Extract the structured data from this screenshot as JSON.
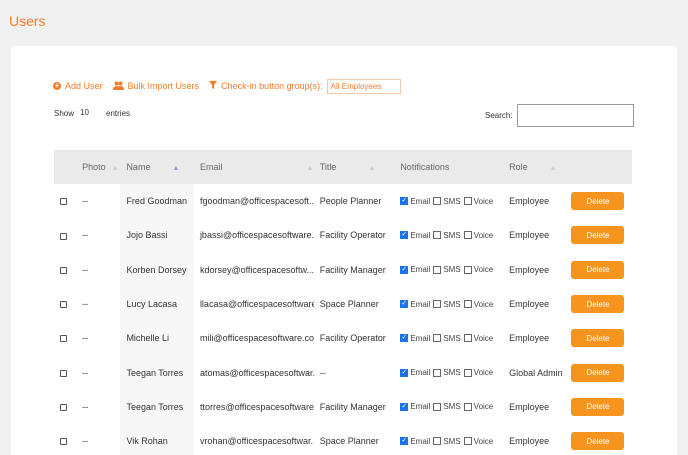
{
  "page_title": "Users",
  "toolbar": {
    "add_user": "Add User",
    "bulk_import": "Bulk Import Users",
    "checkin_label": "Check-in button group(s):",
    "checkin_value": "All Employees"
  },
  "show": {
    "prefix": "Show",
    "value": "10",
    "suffix": "entries"
  },
  "search": {
    "label": "Search:",
    "value": ""
  },
  "columns": {
    "photo": "Photo",
    "name": "Name",
    "email": "Email",
    "title": "Title",
    "notifications": "Notifications",
    "role": "Role"
  },
  "notif_labels": {
    "email": "Email",
    "sms": "SMS",
    "voice": "Voice"
  },
  "delete_label": "Delete",
  "rows": [
    {
      "photo": "--",
      "name": "Fred Goodman",
      "email": "fgoodman@officespacesoft...",
      "title": "People Planner",
      "role": "Employee"
    },
    {
      "photo": "--",
      "name": "Jojo Bassi",
      "email": "jbassi@officespacesoftware...",
      "title": "Facility Operator",
      "role": "Employee"
    },
    {
      "photo": "--",
      "name": "Korben Dorsey",
      "email": "kdorsey@officespacesoftw...",
      "title": "Facility Manager",
      "role": "Employee"
    },
    {
      "photo": "--",
      "name": "Lucy Lacasa",
      "email": "llacasa@officespacesoftware...",
      "title": "Space Planner",
      "role": "Employee"
    },
    {
      "photo": "--",
      "name": "Michelle Li",
      "email": "mili@officespacesoftware.co...",
      "title": "Facility Operator",
      "role": "Employee"
    },
    {
      "photo": "--",
      "name": "Teegan Torres",
      "email": "atomas@officespacesoftwar...",
      "title": "--",
      "role": "Global Admin"
    },
    {
      "photo": "--",
      "name": "Teegan Torres",
      "email": "ttorres@officespacesoftware...",
      "title": "Facility Manager",
      "role": "Employee"
    },
    {
      "photo": "--",
      "name": "Vik Rohan",
      "email": "vrohan@officespacesoftwar...",
      "title": "Space Planner",
      "role": "Employee"
    }
  ]
}
